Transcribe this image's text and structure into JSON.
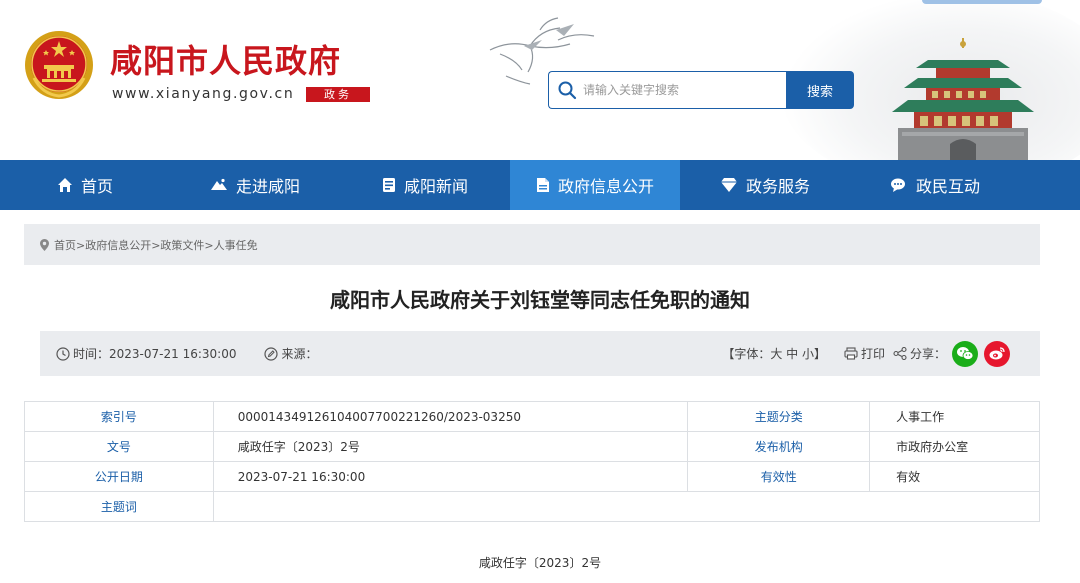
{
  "header": {
    "site_title": "咸阳市人民政府",
    "site_url": "www.xianyang.gov.cn",
    "url_badge": "政务",
    "search_placeholder": "请输入关键字搜索",
    "search_button": "搜索"
  },
  "nav": {
    "items": [
      {
        "label": "首页",
        "icon": "home-icon"
      },
      {
        "label": "走进咸阳",
        "icon": "mountain-icon"
      },
      {
        "label": "咸阳新闻",
        "icon": "news-icon"
      },
      {
        "label": "政府信息公开",
        "icon": "document-icon",
        "active": true
      },
      {
        "label": "政务服务",
        "icon": "diamond-icon"
      },
      {
        "label": "政民互动",
        "icon": "chat-icon"
      }
    ]
  },
  "breadcrumb": {
    "text": "首页>政府信息公开>政策文件>人事任免"
  },
  "article": {
    "title": "咸阳市人民政府关于刘钰堂等同志任免职的通知",
    "time_label": "时间：",
    "time_value": "2023-07-21 16:30:00",
    "source_label": "来源：",
    "source_value": "",
    "font_size_control": "【字体：大 中 小】",
    "print_label": "打印",
    "share_label": "分享：",
    "document_number": "咸政任字〔2023〕2号"
  },
  "info_table": {
    "index_no_label": "索引号",
    "index_no_value": "00001434912610400770022126​0/2023-03250",
    "topic_label": "主题分类",
    "topic_value": "人事工作",
    "doc_no_label": "文号",
    "doc_no_value": "咸政任字〔2023〕2号",
    "publisher_label": "发布机构",
    "publisher_value": "市政府办公室",
    "date_label": "公开日期",
    "date_value": "2023-07-21 16:30:00",
    "validity_label": "有效性",
    "validity_value": "有效",
    "keywords_label": "主题词",
    "keywords_value": ""
  },
  "colors": {
    "brand_red": "#c8161d",
    "nav_blue": "#1b5fa8",
    "nav_active": "#2f86d5",
    "wechat_green": "#1aad19",
    "weibo_red": "#e6162d"
  }
}
